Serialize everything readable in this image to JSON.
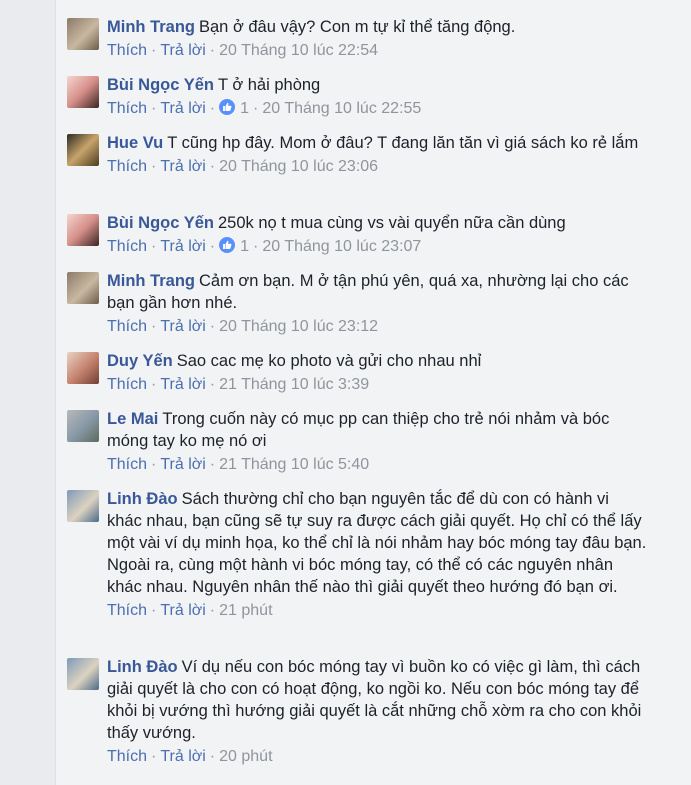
{
  "actions": {
    "like": "Thích",
    "reply": "Trả lời",
    "sep": "·"
  },
  "comments": [
    {
      "author": "Minh Trang",
      "text": "Bạn ở đâu vậy? Con m tự kỉ thể tăng động.",
      "reactions": null,
      "time": "20 Tháng 10 lúc 22:54",
      "avatar": "avatar-minh-trang"
    },
    {
      "author": "Bùi Ngọc Yến",
      "text": "T ở hải phòng",
      "reactions": "1",
      "time": "20 Tháng 10 lúc 22:55",
      "avatar": "avatar-bui-ngoc-yen"
    },
    {
      "author": "Hue Vu",
      "text": "T cũng hp đây. Mom ở đâu? T đang lăn tăn vì giá sách ko rẻ lắm",
      "reactions": null,
      "time": "20 Tháng 10 lúc 23:06",
      "avatar": "avatar-hue-vu"
    },
    {
      "author": "Bùi Ngọc Yến",
      "text": "250k nọ t mua cùng vs vài quyển nữa cần dùng",
      "reactions": "1",
      "time": "20 Tháng 10 lúc 23:07",
      "avatar": "avatar-bui-ngoc-yen"
    },
    {
      "author": "Minh Trang",
      "text": "Cảm ơn bạn. M ở tận phú yên, quá xa, nhường lại cho các bạn gần hơn nhé.",
      "reactions": null,
      "time": "20 Tháng 10 lúc 23:12",
      "avatar": "avatar-minh-trang"
    },
    {
      "author": "Duy Yến",
      "text": "Sao cac mẹ ko photo và gửi cho nhau nhỉ",
      "reactions": null,
      "time": "21 Tháng 10 lúc 3:39",
      "avatar": "avatar-duy-yen"
    },
    {
      "author": "Le Mai",
      "text": "Trong cuốn này có mục pp can thiệp cho trẻ nói nhảm và bóc móng tay ko mẹ nó ơi",
      "reactions": null,
      "time": "21 Tháng 10 lúc 5:40",
      "avatar": "avatar-le-mai"
    },
    {
      "author": "Linh Đào",
      "text": "Sách thường chỉ cho bạn nguyên tắc để dù con có hành vi khác nhau, bạn cũng sẽ tự suy ra được cách giải quyết. Họ chỉ có thể lấy một vài ví dụ minh họa, ko thể chỉ là nói nhảm hay bóc móng tay đâu bạn. Ngoài ra, cùng một hành vi bóc móng tay, có thể có các nguyên nhân khác nhau. Nguyên nhân thế nào thì giải quyết theo hướng đó bạn ơi.",
      "reactions": null,
      "time": "21 phút",
      "avatar": "avatar-linh-dao"
    },
    {
      "author": "Linh Đào",
      "text": "Ví dụ nếu con bóc móng tay vì buồn ko có việc gì làm, thì cách giải quyết là cho con có hoạt động, ko ngồi ko. Nếu con bóc móng tay để khỏi bị vướng thì hướng giải quyết là cắt những chỗ xờm ra cho con khỏi thấy vướng.",
      "reactions": null,
      "time": "20 phút",
      "avatar": "avatar-linh-dao"
    }
  ]
}
